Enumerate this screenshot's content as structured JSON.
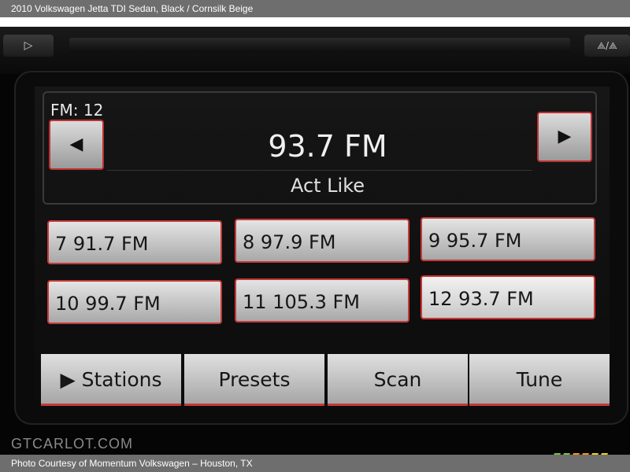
{
  "caption": {
    "title": "2010 Volkswagen Jetta TDI Sedan,  Black / Cornsilk Beige",
    "credit": "Photo Courtesy of Momentum Volkswagen – Houston, TX"
  },
  "watermark": "GTCARLOT.COM",
  "radio": {
    "band": "FM: 12",
    "frequency": "93.7 FM",
    "song": "Act Like",
    "prev_icon": "◀",
    "next_icon": "▶",
    "presets": [
      {
        "label": "7   91.7 FM"
      },
      {
        "label": "8   97.9 FM"
      },
      {
        "label": "9   95.7 FM"
      },
      {
        "label": "10 99.7 FM"
      },
      {
        "label": "11 105.3 FM"
      },
      {
        "label": "12 93.7 FM"
      }
    ],
    "tabs": [
      {
        "label": "▶ Stations"
      },
      {
        "label": "Presets"
      },
      {
        "label": "Scan"
      },
      {
        "label": "Tune"
      }
    ],
    "hardware": {
      "left_icon": "▷",
      "right_label": "⟁/⟁"
    }
  },
  "colors": {
    "accent": "#c43a3a",
    "button": "#dcdcdc",
    "screen_bg": "#111111"
  }
}
